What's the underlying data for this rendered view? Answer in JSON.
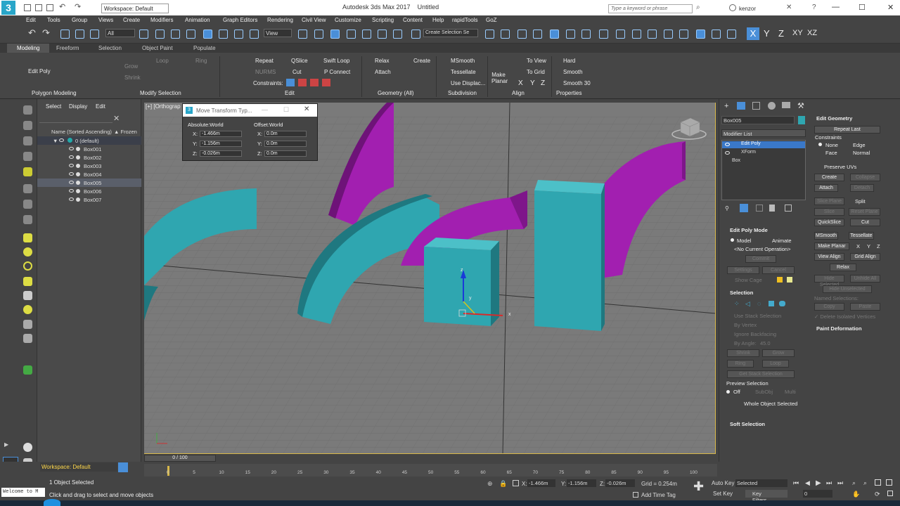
{
  "titlebar": {
    "workspace": "Workspace: Default",
    "app_title": "Autodesk 3ds Max 2017",
    "doc_title": "Untitled",
    "search_placeholder": "Type a keyword or phrase",
    "user": "kenzor"
  },
  "menu": [
    "Edit",
    "Tools",
    "Group",
    "Views",
    "Create",
    "Modifiers",
    "Animation",
    "Graph Editors",
    "Rendering",
    "Civil View",
    "Customize",
    "Scripting",
    "Content",
    "Help",
    "rapidTools",
    "GoZ"
  ],
  "toolbar": {
    "filter": "All",
    "ref_coord": "View",
    "selection_set": "Create Selection Se",
    "axes": [
      "X",
      "Y",
      "Z",
      "XY",
      "XZ"
    ]
  },
  "ribbon_tabs": [
    "Modeling",
    "Freeform",
    "Selection",
    "Object Paint",
    "Populate"
  ],
  "ribbon": {
    "mode_label": "Edit Poly",
    "grow": "Grow",
    "shrink": "Shrink",
    "loop": "Loop",
    "ring": "Ring",
    "nurms": "NURMS",
    "repeat": "Repeat",
    "qslice": "QSlice",
    "swift_loop": "Swift Loop",
    "cut": "Cut",
    "p_connect": "P Connect",
    "constraints": "Constraints:",
    "relax": "Relax",
    "create": "Create",
    "attach": "Attach",
    "msmooth": "MSmooth",
    "tessellate": "Tessellate",
    "use_displace": "Use Displac...",
    "make_planar": "Make Planar",
    "to_view": "To View",
    "to_grid": "To Grid",
    "xyz": [
      "X",
      "Y",
      "Z"
    ],
    "hard": "Hard",
    "smooth": "Smooth",
    "smooth30": "Smooth 30",
    "groups": {
      "polygon_modeling": "Polygon Modeling",
      "modify_selection": "Modify Selection",
      "edit": "Edit",
      "geometry": "Geometry (All)",
      "subdivision": "Subdivision",
      "align": "Align",
      "properties": "Properties"
    }
  },
  "scene_explorer": {
    "tabs": [
      "Select",
      "Display",
      "Edit"
    ],
    "col_name": "Name (Sorted Ascending)",
    "col_frozen": "▲ Frozen",
    "layer": "0 (default)",
    "objects": [
      "Box001",
      "Box002",
      "Box003",
      "Box004",
      "Box005",
      "Box006",
      "Box007"
    ],
    "selected_index": 4
  },
  "viewport": {
    "label": "[+] [Orthograp",
    "gizmo_axes": [
      "z",
      "x",
      "y"
    ]
  },
  "transform_dialog": {
    "title": "Move Transform Typ...",
    "absolute": "Absolute:World",
    "offset": "Offset:World",
    "abs_x": "-1.466m",
    "abs_y": "-1.156m",
    "abs_z": "-0.026m",
    "off_x": "0.0m",
    "off_y": "0.0m",
    "off_z": "0.0m",
    "labels": [
      "X:",
      "Y:",
      "Z:"
    ]
  },
  "command_panel": {
    "object_name": "Box005",
    "modifier_list": "Modifier List",
    "stack": [
      "Edit Poly",
      "XForm",
      "Box"
    ],
    "edit_poly_mode": "Edit Poly Mode",
    "model": "Model",
    "animate": "Animate",
    "no_op": "<No Current Operation>",
    "commit": "Commit",
    "settings": "Settings",
    "cancel": "Cancel",
    "show_cage": "Show Cage",
    "selection": "Selection",
    "use_stack": "Use Stack Selection",
    "by_vertex": "By Vertex",
    "ignore_backfacing": "Ignore Backfacing",
    "by_angle": "By Angle:",
    "by_angle_val": "45.0",
    "shrink": "Shrink",
    "grow": "Grow",
    "ring": "Ring",
    "loop": "Loop",
    "get_stack": "Get Stack Selection",
    "preview_selection": "Preview Selection",
    "off": "Off",
    "subobj": "SubObj",
    "multi": "Multi",
    "whole_object": "Whole Object Selected",
    "soft_selection": "Soft Selection",
    "edit_geometry": "Edit Geometry",
    "repeat_last": "Repeat Last",
    "constraints": "Constraints",
    "none": "None",
    "edge": "Edge",
    "face": "Face",
    "normal": "Normal",
    "preserve_uvs": "Preserve UVs",
    "create": "Create",
    "collapse": "Collapse",
    "attach": "Attach",
    "detach": "Detach",
    "slice_plane": "Slice Plane",
    "split": "Split",
    "slice": "Slice",
    "reset_plane": "Reset Plane",
    "quickslice": "QuickSlice",
    "cut": "Cut",
    "msmooth": "MSmooth",
    "tessellate": "Tessellate",
    "make_planar": "Make Planar",
    "x": "X",
    "y": "Y",
    "z": "Z",
    "view_align": "View Align",
    "grid_align": "Grid Align",
    "relax": "Relax",
    "hide_selected": "Hide Selected",
    "unhide_all": "Unhide All",
    "hide_unselected": "Hide Unselected",
    "named_selections": "Named Selections:",
    "copy": "Copy",
    "paste": "Paste",
    "delete_isolated": "✓ Delete Isolated Vertices",
    "paint_deformation": "Paint Deformation"
  },
  "bottom": {
    "workspace": "Workspace: Default",
    "timeline": "0 / 100",
    "ticks": [
      "0",
      "5",
      "10",
      "15",
      "20",
      "25",
      "30",
      "35",
      "40",
      "45",
      "50",
      "55",
      "60",
      "65",
      "70",
      "75",
      "80",
      "85",
      "90",
      "95",
      "100"
    ],
    "status": "1 Object Selected",
    "prompt": "Click and drag to select and move objects",
    "welcome": "Welcome to M",
    "x_label": "X:",
    "x_val": "-1.466m",
    "y_label": "Y:",
    "y_val": "-1.156m",
    "z_label": "Z:",
    "z_val": "-0.026m",
    "grid": "Grid = 0.254m",
    "add_time_tag": "Add Time Tag",
    "auto_key": "Auto Key",
    "set_key": "Set Key",
    "selected": "Selected",
    "key_filters": "Key Filters...",
    "frame": "0"
  },
  "colors": {
    "teal": "#2fa6b0",
    "purple": "#a21fb0",
    "selection_blue": "#3a78c8"
  }
}
